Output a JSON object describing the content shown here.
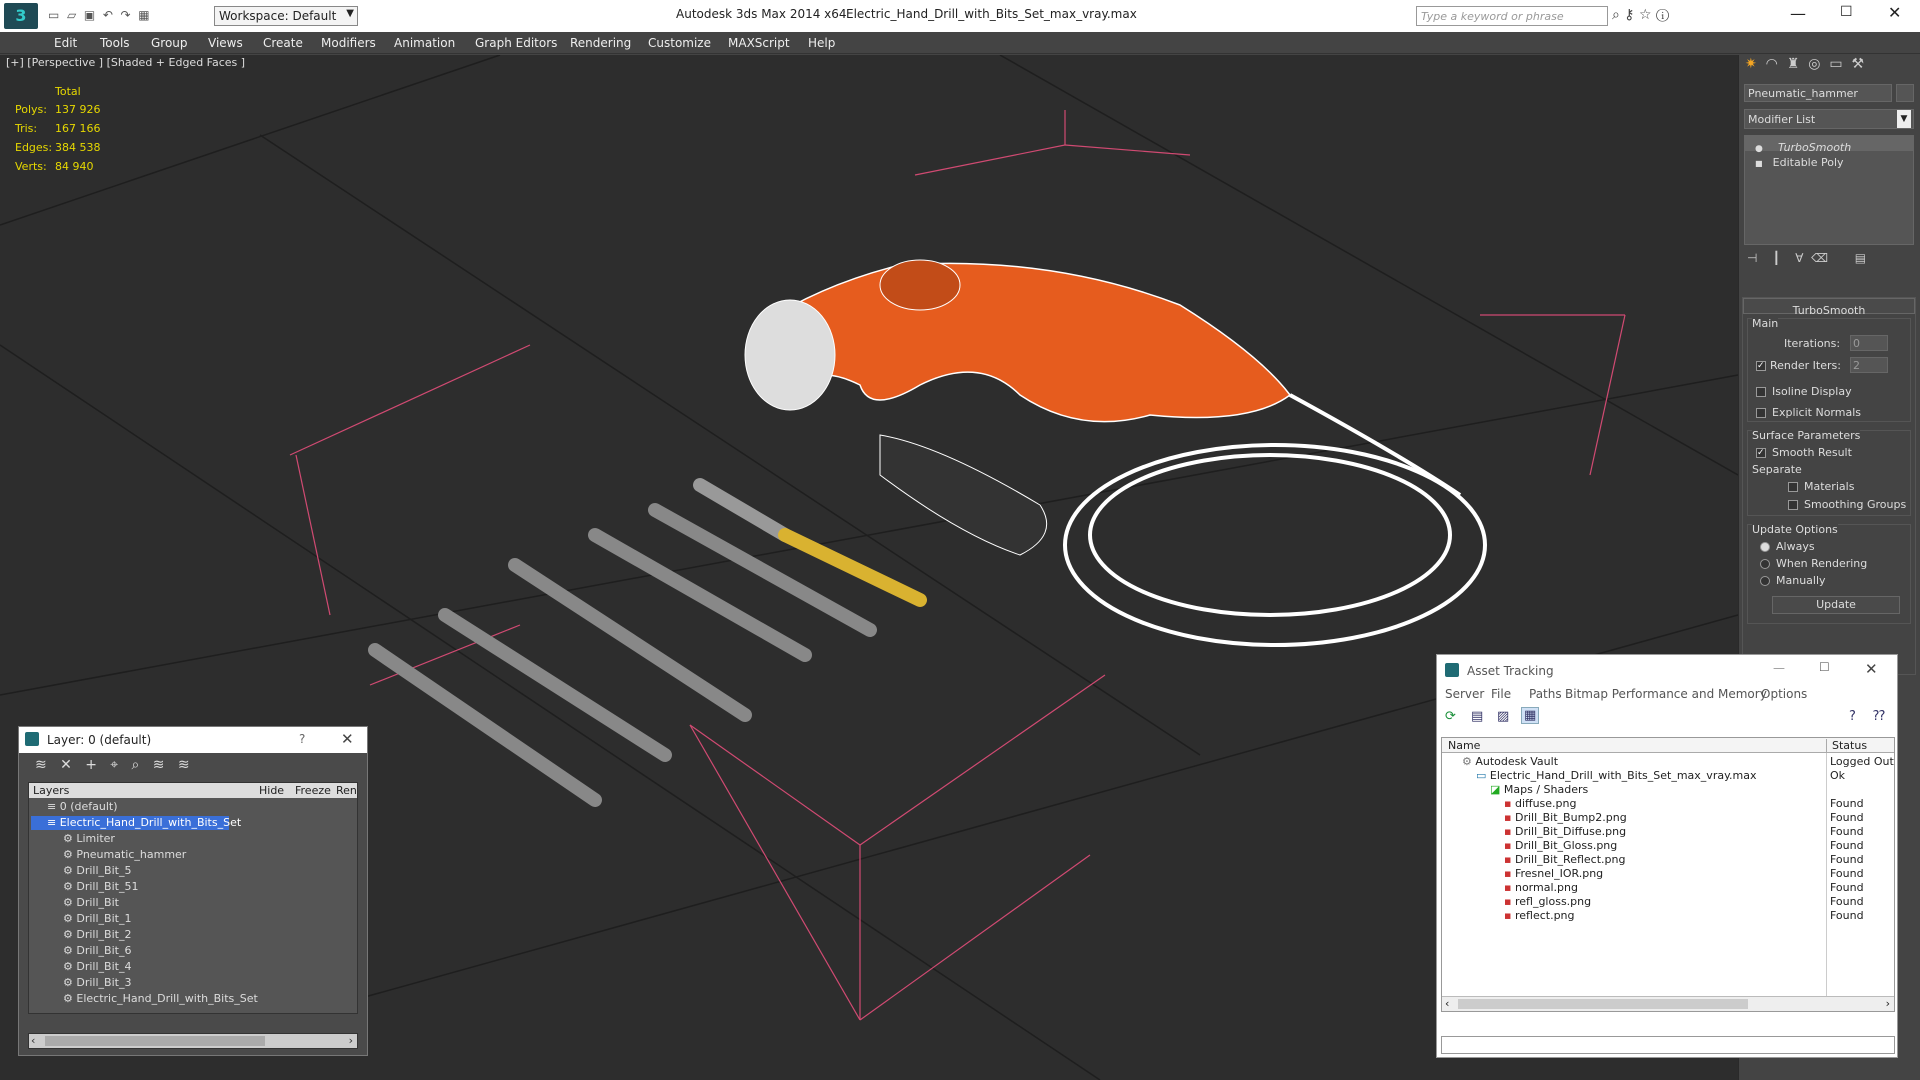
{
  "titlebar": {
    "app": "Autodesk 3ds Max  2014 x64",
    "file": "Electric_Hand_Drill_with_Bits_Set_max_vray.max",
    "workspace": "Workspace: Default",
    "search_placeholder": "Type a keyword or phrase"
  },
  "menu": [
    "Edit",
    "Tools",
    "Group",
    "Views",
    "Create",
    "Modifiers",
    "Animation",
    "Graph Editors",
    "Rendering",
    "Customize",
    "MAXScript",
    "Help"
  ],
  "viewport": {
    "label": "[+] [Perspective ] [Shaded + Edged Faces ]",
    "stats": {
      "total": "Total",
      "polys_label": "Polys:",
      "polys": "137 926",
      "tris_label": "Tris:",
      "tris": "167 166",
      "edges_label": "Edges:",
      "edges": "384 538",
      "verts_label": "Verts:",
      "verts": "84 940"
    }
  },
  "cmd": {
    "object_name": "Pneumatic_hammer",
    "modifier_list": "Modifier List",
    "stack": [
      "TurboSmooth",
      "Editable Poly"
    ],
    "rollout": "TurboSmooth",
    "main": "Main",
    "iterations_label": "Iterations:",
    "iterations": "0",
    "render_iters_label": "Render Iters:",
    "render_iters": "2",
    "isoline": "Isoline Display",
    "explicit": "Explicit Normals",
    "surface": "Surface Parameters",
    "smooth": "Smooth Result",
    "separate": "Separate",
    "materials": "Materials",
    "smoothing": "Smoothing Groups",
    "update_options": "Update Options",
    "always": "Always",
    "when_rendering": "When Rendering",
    "manually": "Manually",
    "update_btn": "Update"
  },
  "layers": {
    "title": "Layer: 0 (default)",
    "help": "?",
    "col_layers": "Layers",
    "col_hide": "Hide",
    "col_freeze": "Freeze",
    "col_ren": "Ren",
    "items": [
      "0 (default)",
      "Electric_Hand_Drill_with_Bits_Set",
      "Limiter",
      "Pneumatic_hammer",
      "Drill_Bit_5",
      "Drill_Bit_51",
      "Drill_Bit",
      "Drill_Bit_1",
      "Drill_Bit_2",
      "Drill_Bit_6",
      "Drill_Bit_4",
      "Drill_Bit_3",
      "Electric_Hand_Drill_with_Bits_Set"
    ]
  },
  "assets": {
    "title": "Asset Tracking",
    "menu": [
      "Server",
      "File",
      "Paths",
      "Bitmap Performance and Memory",
      "Options"
    ],
    "col_name": "Name",
    "col_status": "Status",
    "rows": [
      {
        "name": "Autodesk Vault",
        "status": "Logged Out"
      },
      {
        "name": "Electric_Hand_Drill_with_Bits_Set_max_vray.max",
        "status": "Ok"
      },
      {
        "name": "Maps / Shaders",
        "status": ""
      },
      {
        "name": "diffuse.png",
        "status": "Found"
      },
      {
        "name": "Drill_Bit_Bump2.png",
        "status": "Found"
      },
      {
        "name": "Drill_Bit_Diffuse.png",
        "status": "Found"
      },
      {
        "name": "Drill_Bit_Gloss.png",
        "status": "Found"
      },
      {
        "name": "Drill_Bit_Reflect.png",
        "status": "Found"
      },
      {
        "name": "Fresnel_IOR.png",
        "status": "Found"
      },
      {
        "name": "normal.png",
        "status": "Found"
      },
      {
        "name": "refl_gloss.png",
        "status": "Found"
      },
      {
        "name": "reflect.png",
        "status": "Found"
      }
    ]
  },
  "colors": {
    "accent": "#e65c1e",
    "selection": "#3a6fd8",
    "stat": "#e6d800"
  }
}
